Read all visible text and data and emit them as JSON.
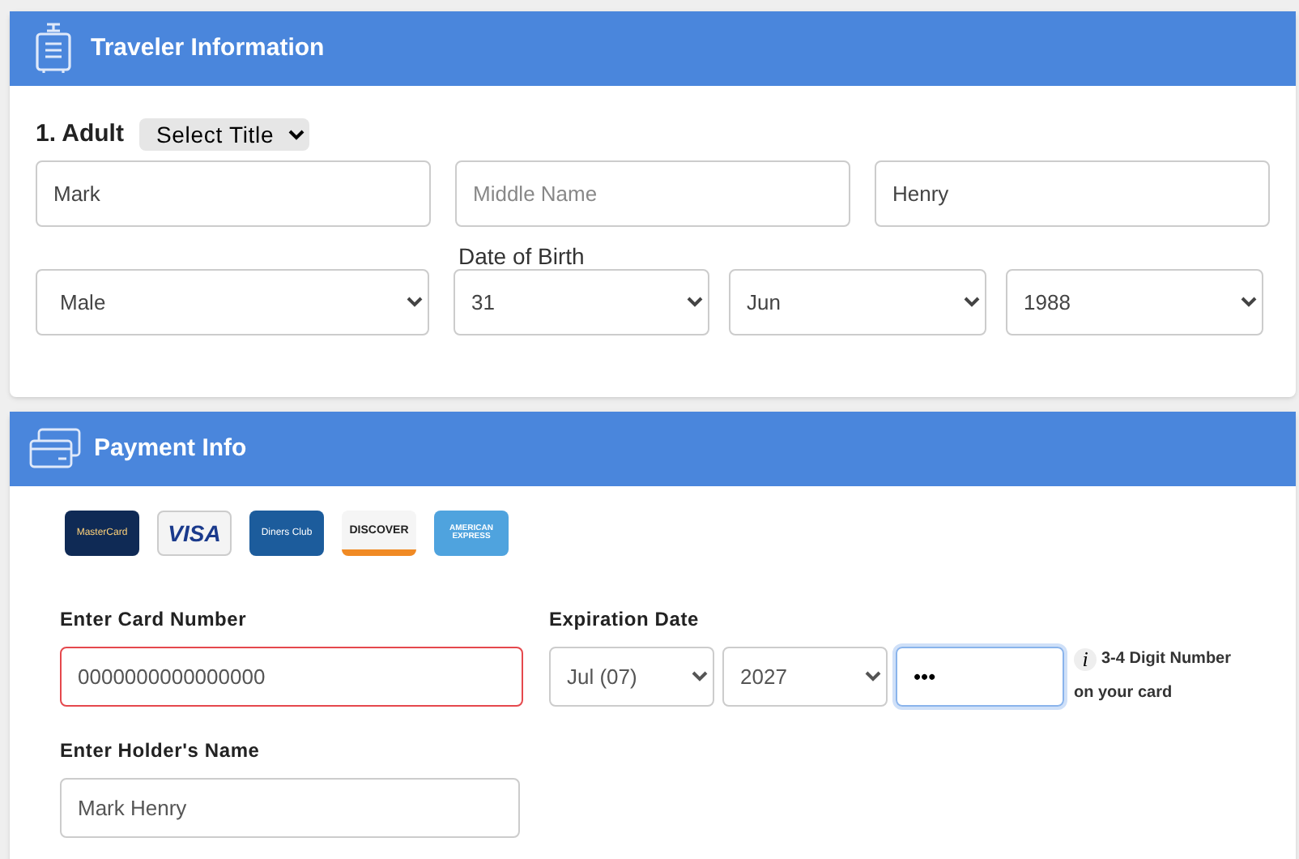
{
  "traveler": {
    "title": "Traveler Information",
    "adult_label": "1. Adult",
    "title_select": "Select Title",
    "first_name": {
      "value": "Mark"
    },
    "middle_name": {
      "placeholder": "Middle Name"
    },
    "last_name": {
      "value": "Henry"
    },
    "gender": "Male",
    "dob_label": "Date of Birth",
    "dob_day": "31",
    "dob_month": "Jun",
    "dob_year": "1988"
  },
  "payment": {
    "title": "Payment Info",
    "card_logos": [
      {
        "kind": "mastercard",
        "label": "MasterCard"
      },
      {
        "kind": "visa",
        "label": "VISA"
      },
      {
        "kind": "diners",
        "label": "Diners Club"
      },
      {
        "kind": "discover",
        "label": "DISCOVER"
      },
      {
        "kind": "amex",
        "label": "AMERICAN EXPRESS"
      }
    ],
    "card_number_label": "Enter Card Number",
    "card_number": {
      "value": "0000000000000000",
      "invalid": true
    },
    "expiration_label": "Expiration Date",
    "exp_month": "Jul (07)",
    "exp_year": "2027",
    "cvv": {
      "value": "•••",
      "focused": true
    },
    "cvv_hint_line1": "3-4 Digit Number",
    "cvv_hint_line2": "on your card",
    "info_glyph": "i",
    "holder_label": "Enter Holder's Name",
    "holder_name": {
      "value": "Mark Henry"
    }
  }
}
